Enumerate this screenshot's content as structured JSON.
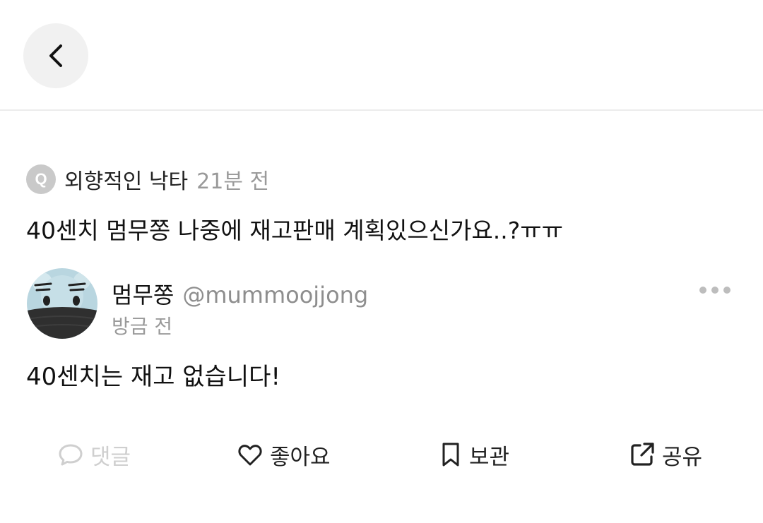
{
  "header": {
    "back_label": "back"
  },
  "question": {
    "badge": "Q",
    "asker": "외향적인 낙타",
    "time": "21분 전",
    "text": "40센치 멈무쫑 나중에 재고판매 계획있으신가요..?ㅠㅠ"
  },
  "answer": {
    "author_name": "멈무쫑",
    "author_handle": "@mummoojjong",
    "time": "방금 전",
    "text": "40센치는 재고 없습니다!"
  },
  "actions": [
    {
      "label": "댓글",
      "icon": "speech-bubble-icon",
      "enabled": false
    },
    {
      "label": "좋아요",
      "icon": "heart-icon",
      "enabled": true
    },
    {
      "label": "보관",
      "icon": "bookmark-icon",
      "enabled": true
    },
    {
      "label": "공유",
      "icon": "share-icon",
      "enabled": true
    }
  ],
  "colors": {
    "muted": "#9a9a9a",
    "disabled": "#cfcfcf",
    "text": "#111111",
    "divider": "#ececec"
  }
}
